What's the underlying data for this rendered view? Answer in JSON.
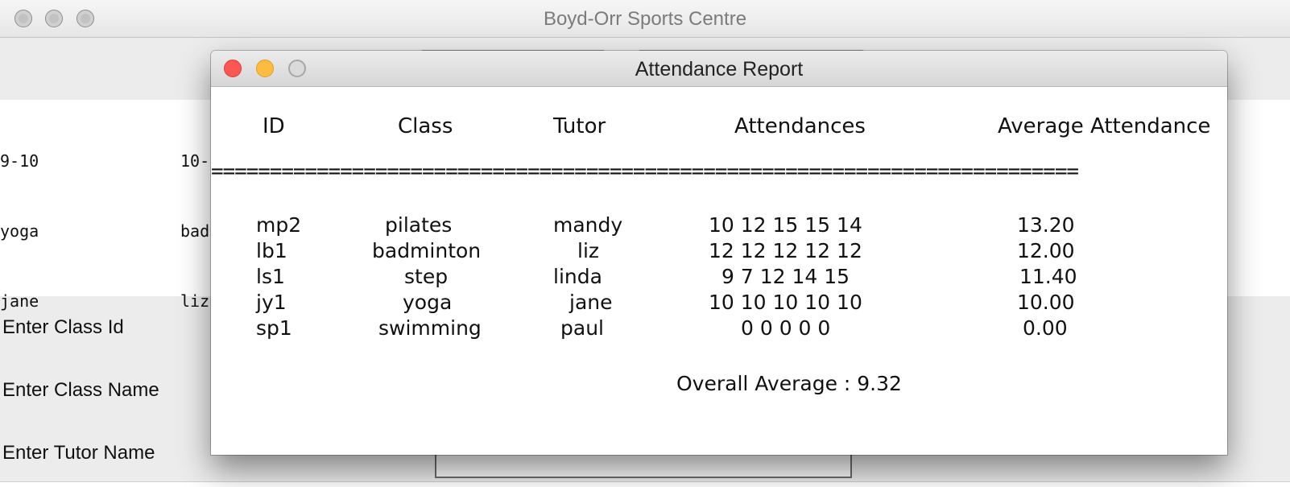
{
  "main_window": {
    "title": "Boyd-Orr Sports Centre",
    "timetable": {
      "columns": [
        {
          "lines": [
            "9-10",
            "yoga",
            "jane"
          ]
        },
        {
          "lines": [
            "10-",
            "bad",
            "liz"
          ]
        }
      ]
    },
    "form": {
      "class_id_label": "Enter Class Id",
      "class_name_label": "Enter Class Name",
      "tutor_name_label": "Enter Tutor Name"
    }
  },
  "dialog": {
    "title": "Attendance Report",
    "headers": {
      "id": "ID",
      "class": "Class",
      "tutor": "Tutor",
      "attendances": "Attendances",
      "average": "Average Attendance"
    },
    "separator": "==========================================================================",
    "rows": [
      {
        "id": "mp2",
        "class": "pilates",
        "tutor": "mandy",
        "attendances": "10 12 15 15 14",
        "average": "13.20"
      },
      {
        "id": "lb1",
        "class": "badminton",
        "tutor": "liz",
        "attendances": "12 12 12 12 12",
        "average": "12.00"
      },
      {
        "id": "ls1",
        "class": "step",
        "tutor": "linda",
        "attendances": "9 7 12 14 15",
        "average": "11.40"
      },
      {
        "id": "jy1",
        "class": "yoga",
        "tutor": "jane",
        "attendances": "10 10 10 10 10",
        "average": "10.00"
      },
      {
        "id": "sp1",
        "class": "swimming",
        "tutor": "paul",
        "attendances": "0 0 0 0 0",
        "average": "0.00"
      }
    ],
    "overall_average": "Overall Average : 9.32"
  }
}
